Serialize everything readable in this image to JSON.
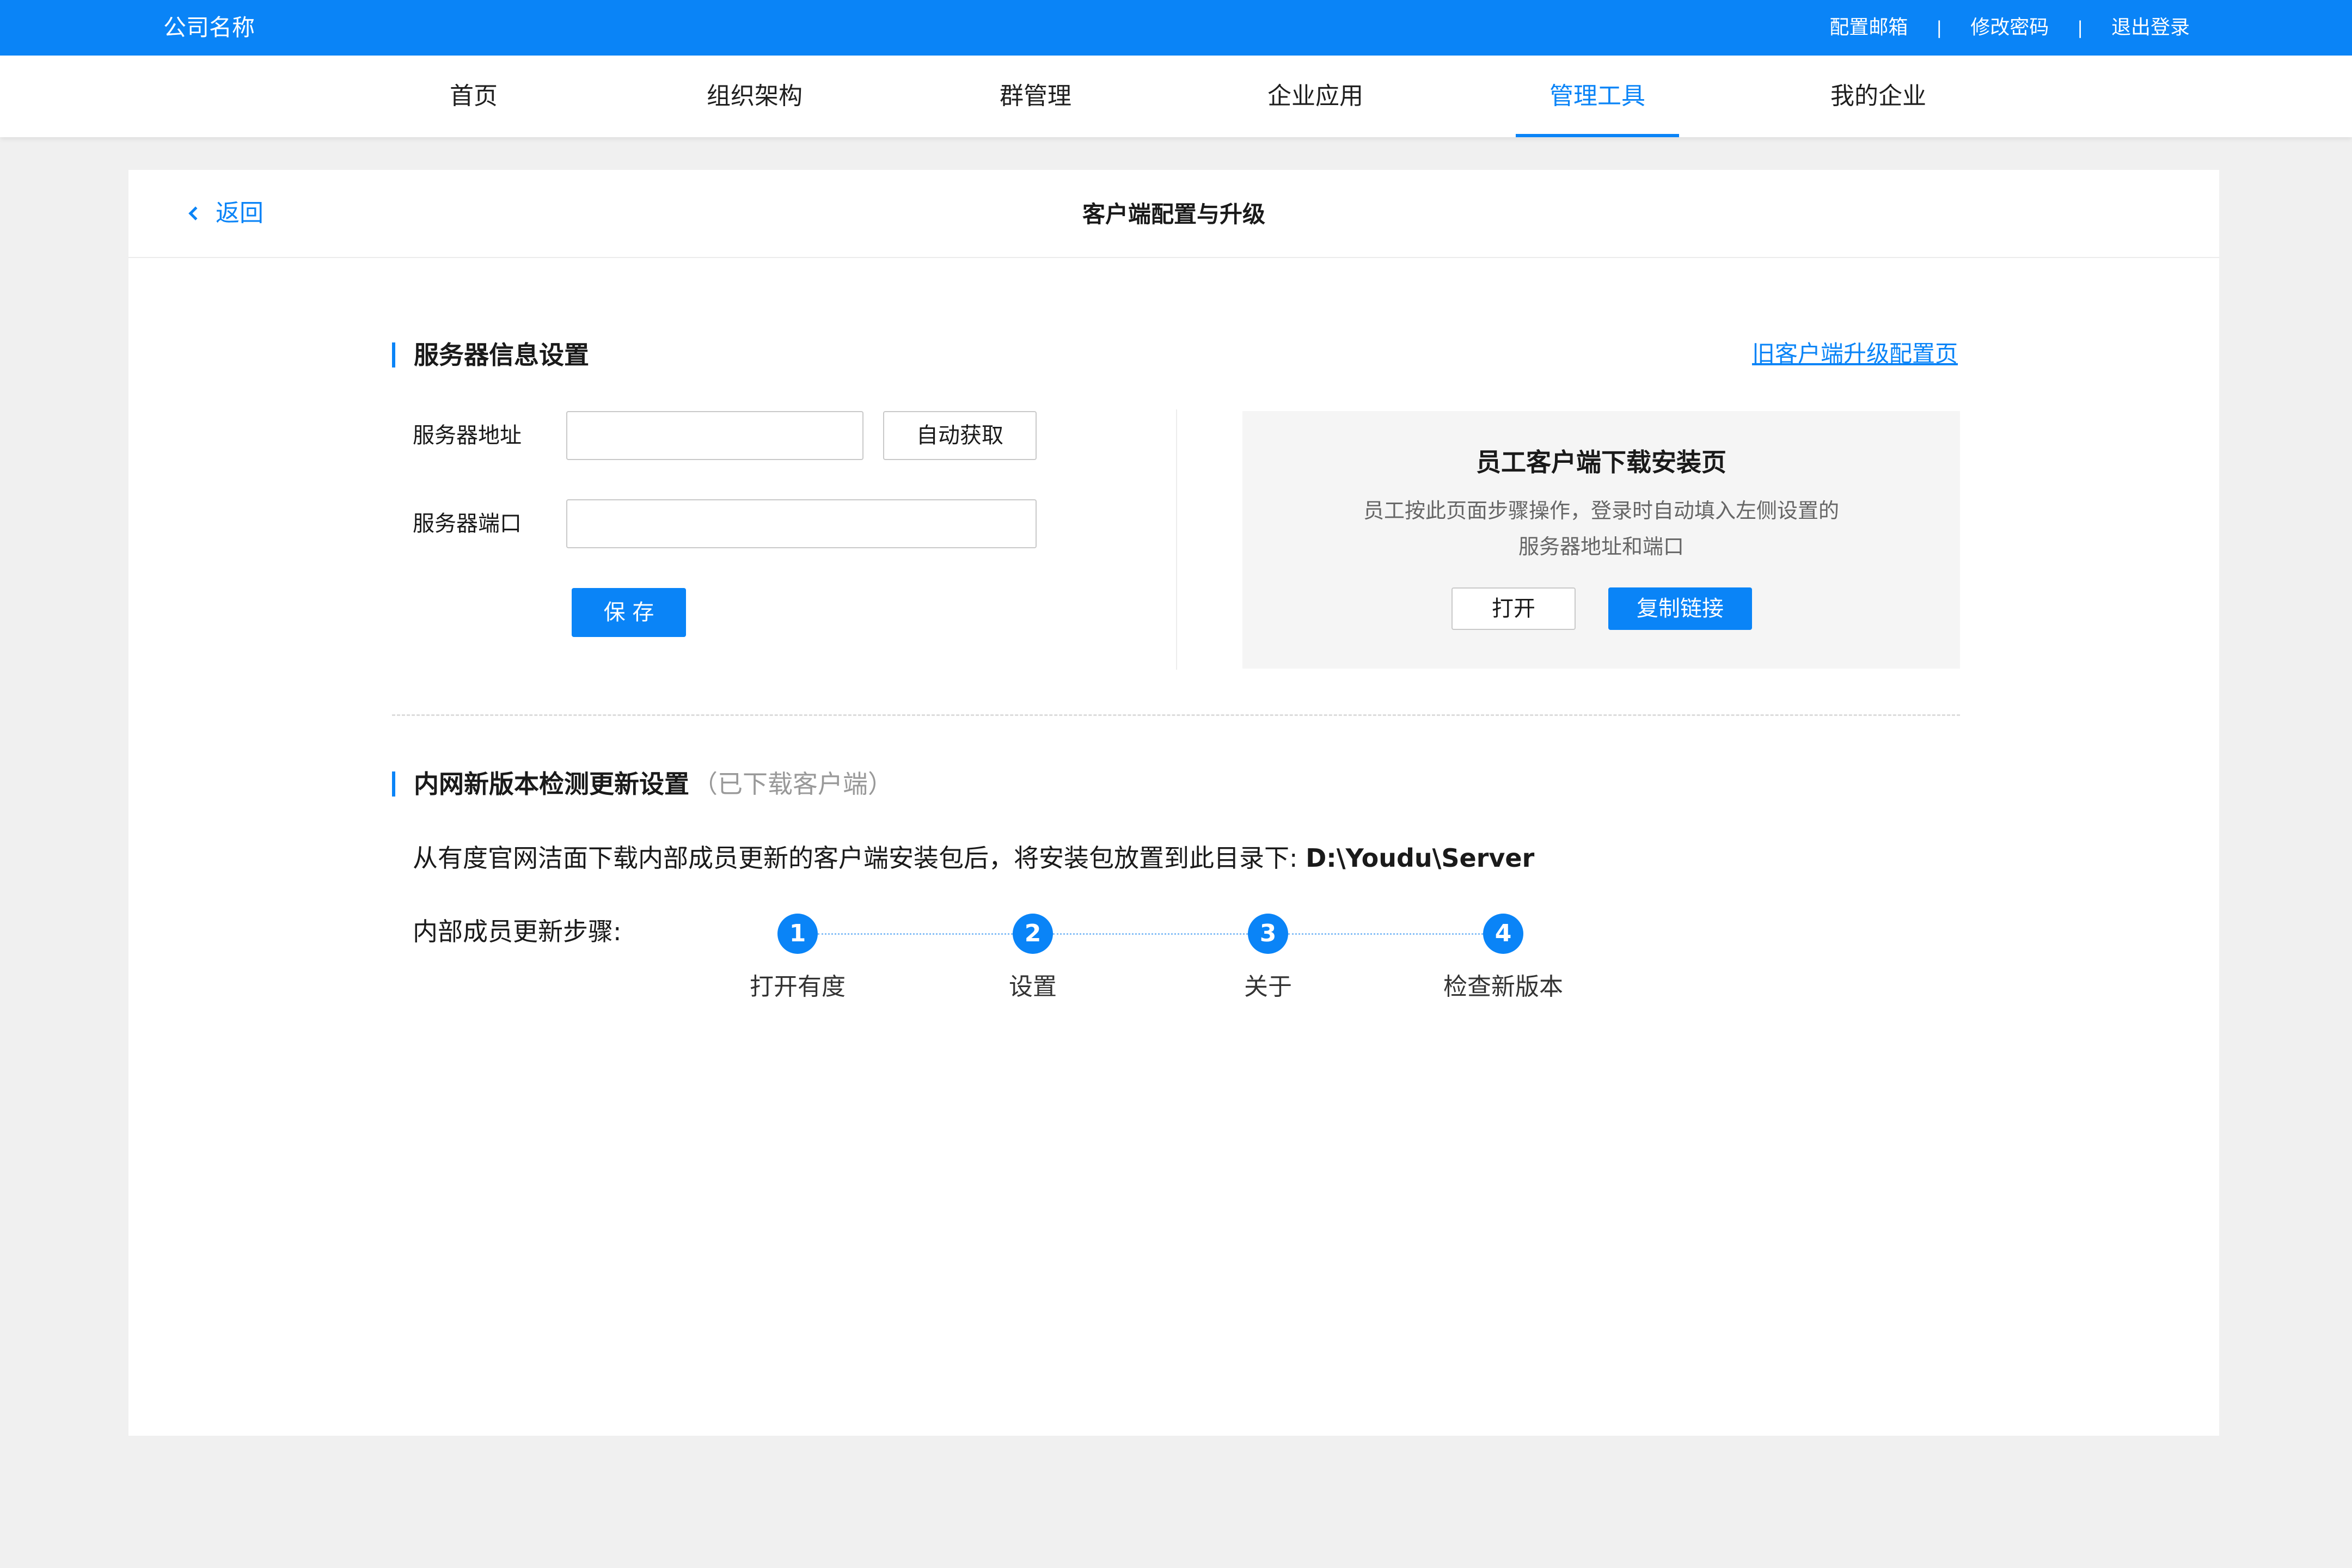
{
  "topbar": {
    "company_name": "公司名称",
    "links": [
      "配置邮箱",
      "修改密码",
      "退出登录"
    ],
    "separator": "|"
  },
  "nav": {
    "items": [
      "首页",
      "组织架构",
      "群管理",
      "企业应用",
      "管理工具",
      "我的企业"
    ],
    "active": "管理工具"
  },
  "header": {
    "back_label": "返回",
    "title": "客户端配置与升级"
  },
  "server_section": {
    "title": "服务器信息设置",
    "old_client_link": "旧客户端升级配置页",
    "address_label": "服务器地址",
    "address_value": "",
    "auto_fetch_label": "自动获取",
    "port_label": "服务器端口",
    "port_value": "",
    "save_label": "保 存"
  },
  "download_panel": {
    "title": "员工客户端下载安装页",
    "desc_line1": "员工按此页面步骤操作，登录时自动填入左侧设置的",
    "desc_line2": "服务器地址和端口",
    "open_label": "打开",
    "copy_label": "复制链接"
  },
  "update_section": {
    "title": "内网新版本检测更新设置",
    "note": "（已下载客户端）",
    "desc_prefix": "从有度官网洁面下载内部成员更新的客户端安装包后，将安装包放置到此目录下: ",
    "desc_path": "D:\\Youdu\\Server",
    "steps_label": "内部成员更新步骤:",
    "steps": [
      {
        "num": "1",
        "label": "打开有度"
      },
      {
        "num": "2",
        "label": "设置"
      },
      {
        "num": "3",
        "label": "关于"
      },
      {
        "num": "4",
        "label": "检查新版本"
      }
    ]
  },
  "colors": {
    "primary": "#0a84f7",
    "page_bg": "#f0f0f0",
    "panel_bg": "#f5f5f5"
  }
}
